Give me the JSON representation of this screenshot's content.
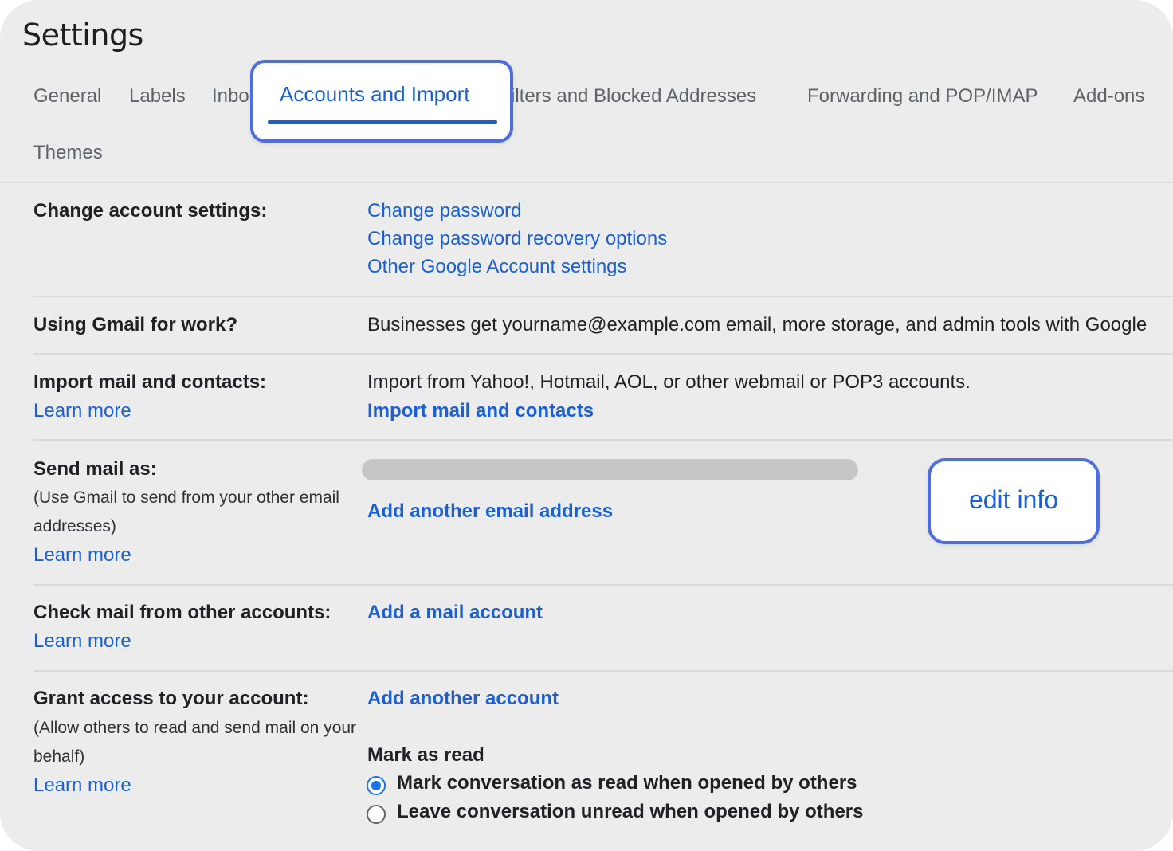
{
  "page": {
    "title": "Settings"
  },
  "tabs": {
    "general": "General",
    "labels": "Labels",
    "inbox": "Inbo",
    "accounts": "Accounts and Import",
    "filters": "ilters and Blocked Addresses",
    "forwarding": "Forwarding and POP/IMAP",
    "addons": "Add-ons",
    "themes": "Themes"
  },
  "sections": {
    "change_account": {
      "label": "Change account settings:",
      "links": [
        "Change password",
        "Change password recovery options",
        "Other Google Account settings"
      ]
    },
    "gmail_work": {
      "label": "Using Gmail for work?",
      "text": "Businesses get yourname@example.com email, more storage, and admin tools with Google"
    },
    "import_mail": {
      "label": "Import mail and contacts:",
      "learn_more": "Learn more",
      "text": "Import from Yahoo!, Hotmail, AOL, or other webmail or POP3 accounts.",
      "action": "Import mail and contacts"
    },
    "send_mail": {
      "label": "Send mail as:",
      "sub_line1": "(Use Gmail to send from your other email",
      "sub_line2": "addresses)",
      "learn_more": "Learn more",
      "action": "Add another email address",
      "edit_label": "edit info"
    },
    "check_mail": {
      "label": "Check mail from other accounts:",
      "learn_more": "Learn more",
      "action": "Add a mail account"
    },
    "grant_access": {
      "label": "Grant access to your account:",
      "sub_line1": "(Allow others to read and send mail on your",
      "sub_line2": "behalf)",
      "learn_more": "Learn more",
      "action": "Add another account",
      "mark_heading": "Mark as read",
      "options": [
        {
          "label": "Mark conversation as read when opened by others",
          "selected": true
        },
        {
          "label": "Leave conversation unread when opened by others",
          "selected": false
        }
      ]
    }
  },
  "colors": {
    "accent": "#1a5fd6",
    "highlight_border": "#4d6ee3",
    "background": "#ececec"
  }
}
